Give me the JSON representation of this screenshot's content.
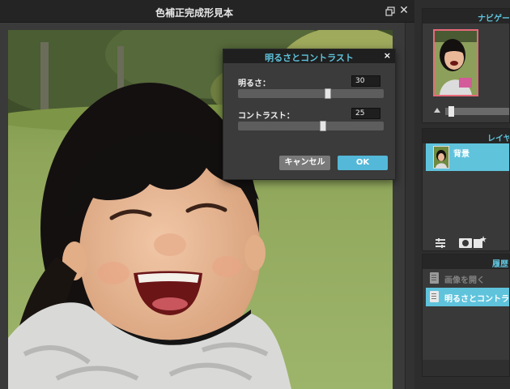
{
  "document": {
    "title": "色補正完成形見本"
  },
  "dialog": {
    "title": "明るさとコントラスト",
    "close_glyph": "×",
    "brightness": {
      "label": "明るさ：",
      "value": "30",
      "level": 0.62
    },
    "contrast": {
      "label": "コントラスト：",
      "value": "25",
      "level": 0.59
    },
    "cancel_label": "キャンセル",
    "ok_label": "OK"
  },
  "panels": {
    "navigator": {
      "title": "ナビゲー",
      "zoom_level": 0.05
    },
    "layers": {
      "title": "レイヤ",
      "items": [
        {
          "name": "背景",
          "selected": true
        }
      ]
    },
    "history": {
      "title": "履歴",
      "items": [
        {
          "label": "画像を開く",
          "selected": false
        },
        {
          "label": "明るさとコントラ",
          "selected": true
        }
      ]
    }
  },
  "colors": {
    "accent": "#5fc3dc",
    "ok_button": "#54b8d8",
    "cancel_button": "#7a7a7a",
    "navigator_frame": "#e8697a",
    "panel_bg": "#393939",
    "window_bg": "#3a3a3a"
  },
  "icons": {
    "doc_restore": "restore-window-icon",
    "doc_close": "close-icon",
    "dialog_close": "close-icon",
    "zoom_small": "mountain-small-icon",
    "layer_adjust": "adjustment-layer-icon",
    "layer_mask": "layer-mask-icon",
    "layer_new": "new-layer-icon",
    "history_item": "document-icon"
  }
}
